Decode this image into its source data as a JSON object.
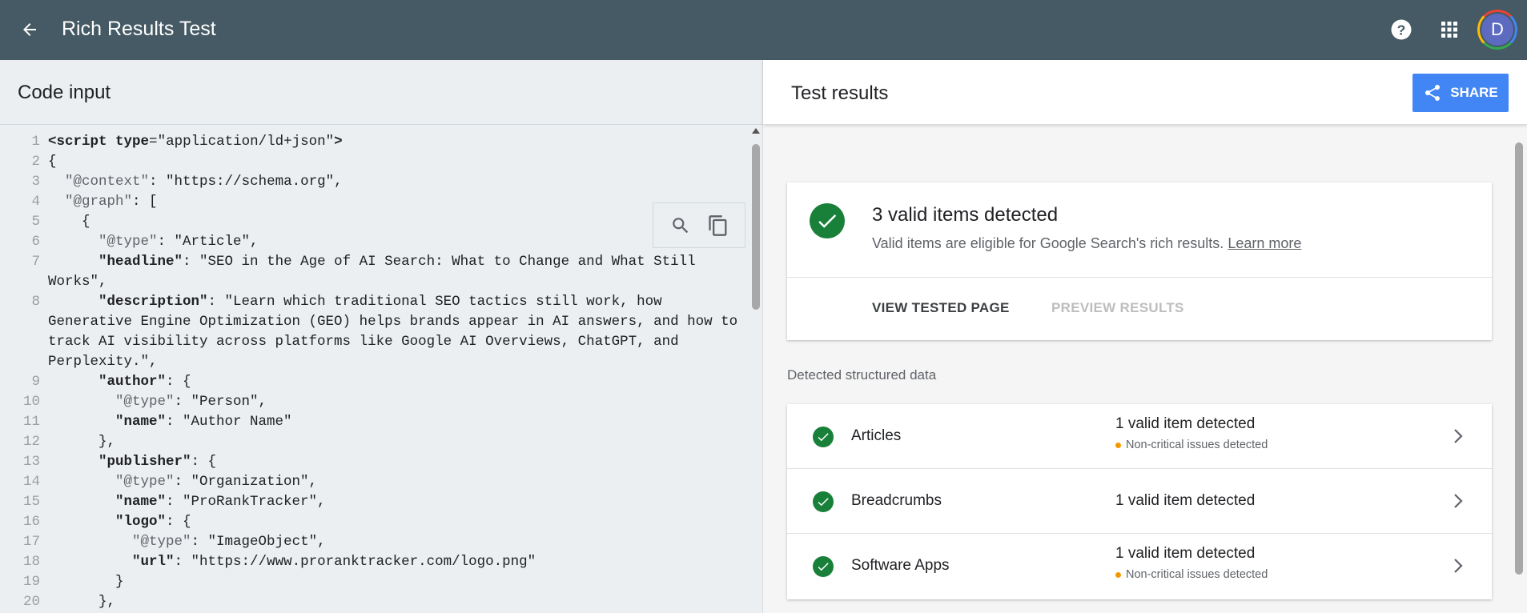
{
  "header": {
    "title": "Rich Results Test",
    "avatar_letter": "D",
    "icons": {
      "back": "arrow-back-icon",
      "help": "help-icon",
      "apps": "apps-grid-icon"
    }
  },
  "code_panel": {
    "title": "Code input",
    "lines": [
      {
        "n": "1",
        "html": "<span class='tok-key'>&lt;script</span> <span class='tok-key'>type</span>=<span class='tok-str'>\"application/ld+json\"</span><span class='tok-key'>&gt;</span>"
      },
      {
        "n": "2",
        "html": "{"
      },
      {
        "n": "3",
        "html": "  <span class='tok-dim'>\"@context\"</span>: \"https://schema.org\","
      },
      {
        "n": "4",
        "html": "  <span class='tok-dim'>\"@graph\"</span>: ["
      },
      {
        "n": "5",
        "html": "    {"
      },
      {
        "n": "6",
        "html": "      <span class='tok-dim'>\"@type\"</span>: \"Article\","
      },
      {
        "n": "7",
        "html": "      <span class='tok-key'>\"headline\"</span>: \"SEO in the Age of AI Search: What to Change and What Still Works\","
      },
      {
        "n": "8",
        "html": "      <span class='tok-key'>\"description\"</span>: \"Learn which traditional SEO tactics still work, how Generative Engine Optimization (GEO) helps brands appear in AI answers, and how to track AI visibility across platforms like Google AI Overviews, ChatGPT, and Perplexity.\","
      },
      {
        "n": "9",
        "html": "      <span class='tok-key'>\"author\"</span>: {"
      },
      {
        "n": "10",
        "html": "        <span class='tok-dim'>\"@type\"</span>: \"Person\","
      },
      {
        "n": "11",
        "html": "        <span class='tok-key'>\"name\"</span>: \"Author Name\""
      },
      {
        "n": "12",
        "html": "      },"
      },
      {
        "n": "13",
        "html": "      <span class='tok-key'>\"publisher\"</span>: {"
      },
      {
        "n": "14",
        "html": "        <span class='tok-dim'>\"@type\"</span>: \"Organization\","
      },
      {
        "n": "15",
        "html": "        <span class='tok-key'>\"name\"</span>: \"ProRankTracker\","
      },
      {
        "n": "16",
        "html": "        <span class='tok-key'>\"logo\"</span>: {"
      },
      {
        "n": "17",
        "html": "          <span class='tok-dim'>\"@type\"</span>: \"ImageObject\","
      },
      {
        "n": "18",
        "html": "          <span class='tok-key'>\"url\"</span>: \"https://www.proranktracker.com/logo.png\""
      },
      {
        "n": "19",
        "html": "        }"
      },
      {
        "n": "20",
        "html": "      },"
      }
    ],
    "tools": {
      "search": "search-icon",
      "copy": "copy-icon"
    }
  },
  "results_panel": {
    "title": "Test results",
    "share_label": "SHARE",
    "summary": {
      "title": "3 valid items detected",
      "subtitle": "Valid items are eligible for Google Search's rich results.",
      "learn_more": "Learn more",
      "view_tested_page": "VIEW TESTED PAGE",
      "preview_results": "PREVIEW RESULTS"
    },
    "detected_label": "Detected structured data",
    "items": [
      {
        "name": "Articles",
        "status": "1 valid item detected",
        "issue": "Non-critical issues detected"
      },
      {
        "name": "Breadcrumbs",
        "status": "1 valid item detected",
        "issue": ""
      },
      {
        "name": "Software Apps",
        "status": "1 valid item detected",
        "issue": "Non-critical issues detected"
      }
    ]
  },
  "colors": {
    "header": "#455a64",
    "accent": "#4285f4",
    "success": "#188038",
    "warning": "#f29900"
  }
}
